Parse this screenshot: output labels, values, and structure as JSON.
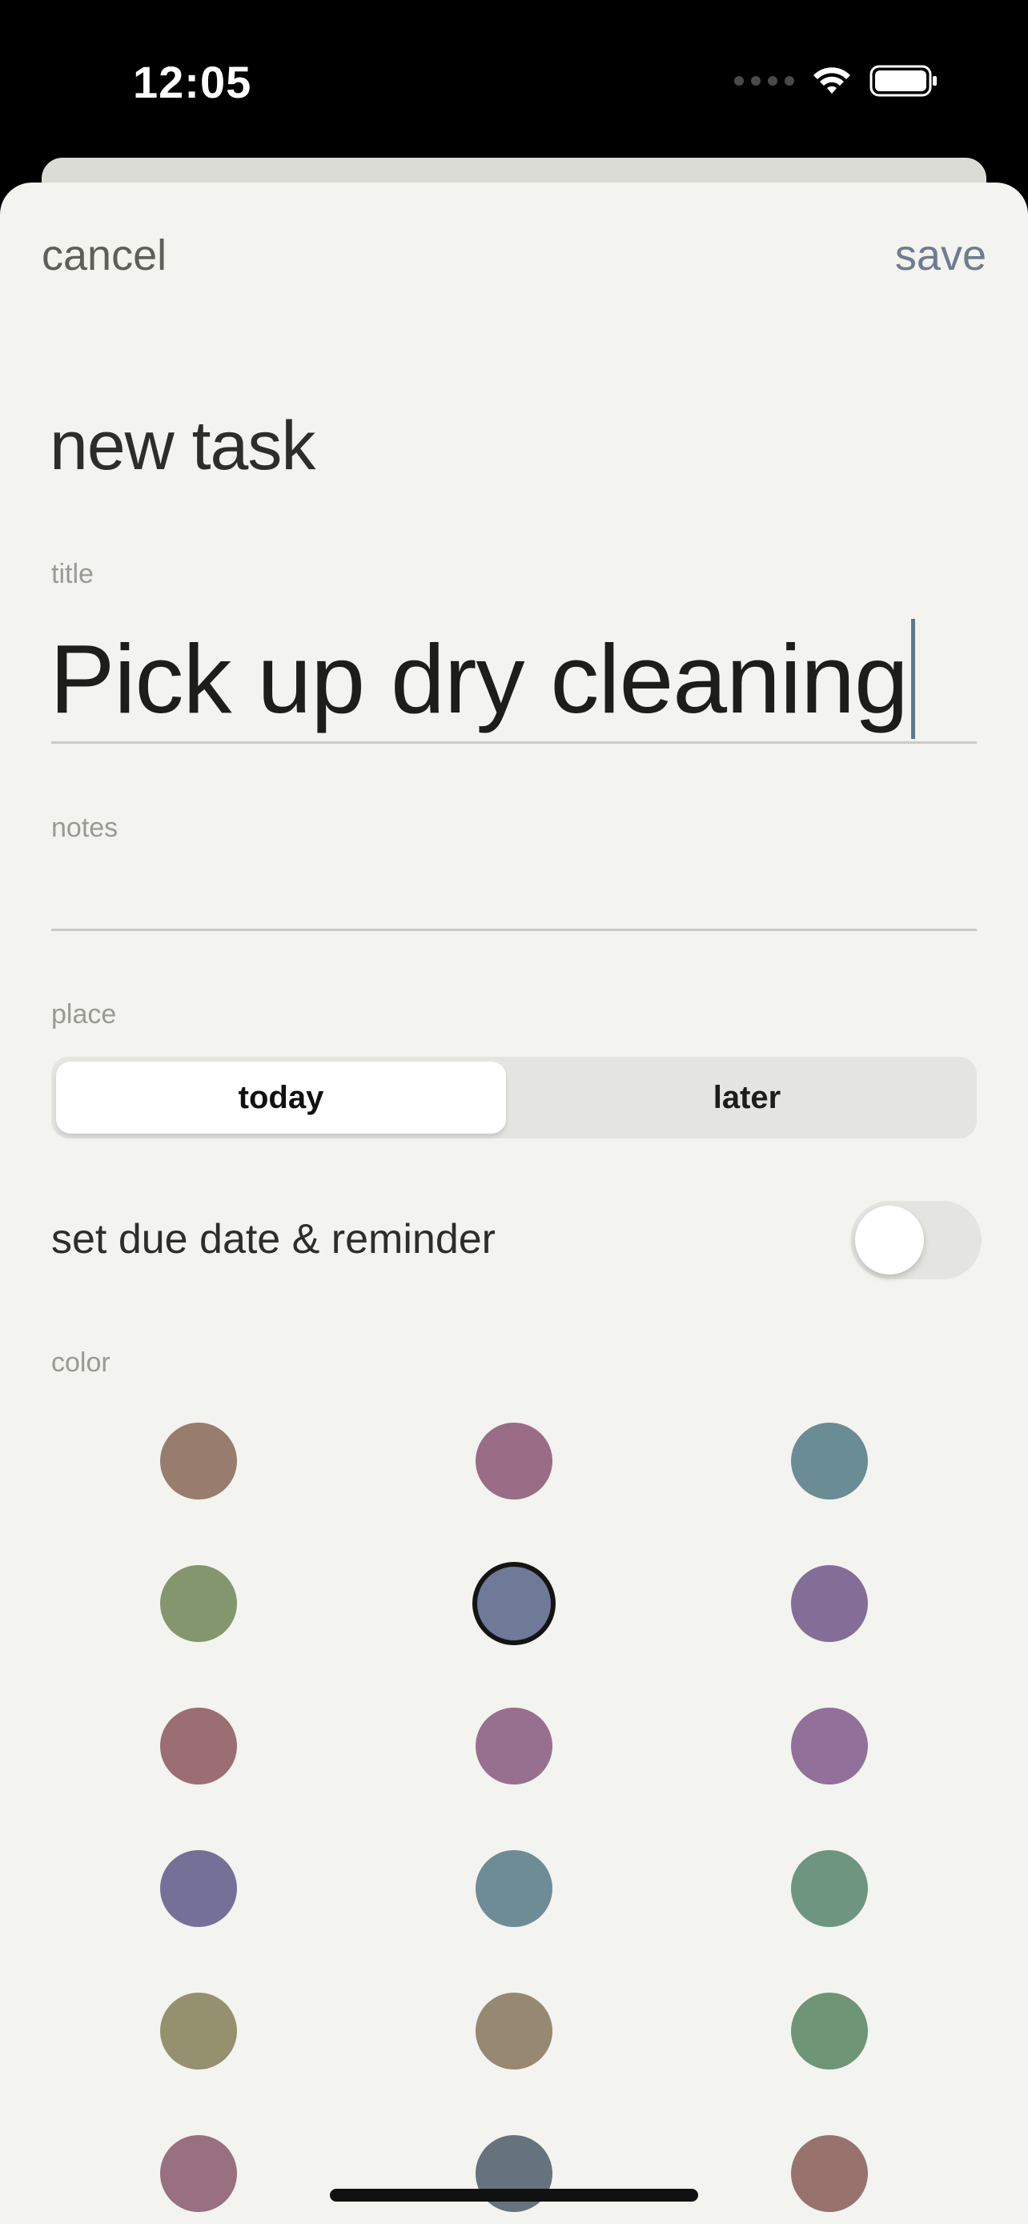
{
  "status_bar": {
    "time": "12:05",
    "wifi_icon": "wifi-icon",
    "battery_icon": "battery-icon",
    "signal_icon": "signal-dots-icon"
  },
  "nav": {
    "cancel_label": "cancel",
    "save_label": "save"
  },
  "page_title": "new task",
  "fields": {
    "title_label": "title",
    "title_value": "Pick up dry cleaning",
    "notes_label": "notes",
    "notes_value": "",
    "place_label": "place",
    "place_options": [
      "today",
      "later"
    ],
    "place_selected": "today",
    "reminder_label": "set due date & reminder",
    "reminder_on": false,
    "color_label": "color"
  },
  "colors": {
    "swatches": [
      "#987d6e",
      "#9a6c85",
      "#6a8c95",
      "#84966e",
      "#6e7a98",
      "#846e98",
      "#9a6e72",
      "#98708f",
      "#917099",
      "#757098",
      "#6e8c95",
      "#6e9580",
      "#95916e",
      "#978871",
      "#6e9576",
      "#98707f",
      "#66737e",
      "#98736e"
    ],
    "selected_index": 4,
    "accent": "#6f7a93",
    "caret": "#5c7a8a"
  }
}
